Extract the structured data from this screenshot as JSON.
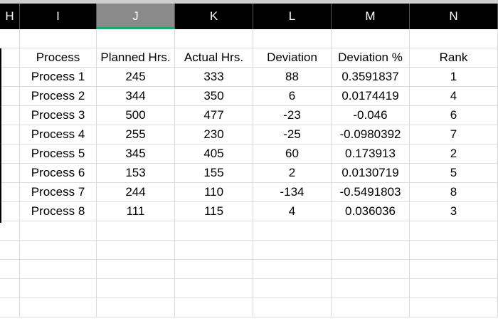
{
  "columns": [
    "H",
    "I",
    "J",
    "K",
    "L",
    "M",
    "N"
  ],
  "selected_column": "J",
  "table": {
    "headers": [
      "Process",
      "Planned Hrs.",
      "Actual Hrs.",
      "Deviation",
      "Deviation %",
      "Rank"
    ],
    "rows": [
      [
        "Process 1",
        "245",
        "333",
        "88",
        "0.3591837",
        "1"
      ],
      [
        "Process 2",
        "344",
        "350",
        "6",
        "0.0174419",
        "4"
      ],
      [
        "Process 3",
        "500",
        "477",
        "-23",
        "-0.046",
        "6"
      ],
      [
        "Process 4",
        "255",
        "230",
        "-25",
        "-0.0980392",
        "7"
      ],
      [
        "Process 5",
        "345",
        "405",
        "60",
        "0.173913",
        "2"
      ],
      [
        "Process 6",
        "153",
        "155",
        "2",
        "0.0130719",
        "5"
      ],
      [
        "Process 7",
        "244",
        "110",
        "-134",
        "-0.5491803",
        "8"
      ],
      [
        "Process 8",
        "111",
        "115",
        "4",
        "0.036036",
        "3"
      ]
    ]
  },
  "colors": {
    "header_bg": "#000000",
    "selected_header": "#8a8a8a",
    "selected_underline": "#22a567",
    "gridline": "#dcdcdc"
  }
}
